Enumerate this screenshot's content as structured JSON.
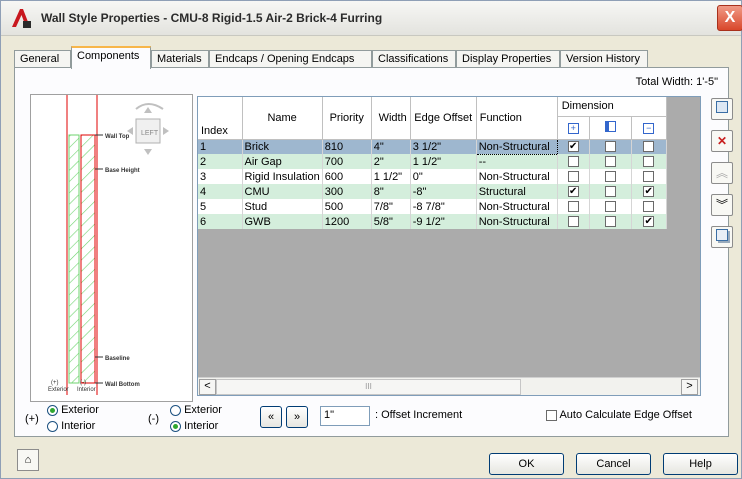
{
  "window": {
    "title": "Wall Style Properties - CMU-8 Rigid-1.5 Air-2 Brick-4 Furring",
    "close_glyph": "X"
  },
  "tabs": [
    {
      "label": "General"
    },
    {
      "label": "Components"
    },
    {
      "label": "Materials"
    },
    {
      "label": "Endcaps / Opening Endcaps"
    },
    {
      "label": "Classifications"
    },
    {
      "label": "Display Properties"
    },
    {
      "label": "Version History"
    }
  ],
  "active_tab": "Components",
  "total_width": "Total Width: 1'-5\"",
  "preview": {
    "view_label": "LEFT",
    "labels": {
      "wall_top": "Wall Top",
      "base_height": "Base Height",
      "baseline": "Baseline",
      "wall_bottom": "Wall Bottom",
      "exterior_sign": "(+)",
      "exterior": "Exterior",
      "interior_sign": "(-)",
      "interior": "Interior"
    }
  },
  "grid": {
    "headers": {
      "index": "Index",
      "name": "Name",
      "priority": "Priority",
      "width": "Width",
      "edge_offset": "Edge Offset",
      "function": "Function",
      "dimension": "Dimension"
    },
    "dimension_icons": [
      "dim-exterior-icon",
      "dim-center-icon",
      "dim-interior-icon"
    ],
    "rows": [
      {
        "index": "1",
        "name": "Brick",
        "priority": "810",
        "width": "4\"",
        "edge_offset": "3 1/2\"",
        "function": "Non-Structural",
        "d1": true,
        "d2": false,
        "d3": false
      },
      {
        "index": "2",
        "name": "Air Gap",
        "priority": "700",
        "width": "2\"",
        "edge_offset": "1 1/2\"",
        "function": "--",
        "d1": false,
        "d2": false,
        "d3": false
      },
      {
        "index": "3",
        "name": "Rigid Insulation",
        "priority": "600",
        "width": "1 1/2\"",
        "edge_offset": "0\"",
        "function": "Non-Structural",
        "d1": false,
        "d2": false,
        "d3": false
      },
      {
        "index": "4",
        "name": "CMU",
        "priority": "300",
        "width": "8\"",
        "edge_offset": "-8\"",
        "function": "Structural",
        "d1": true,
        "d2": false,
        "d3": true
      },
      {
        "index": "5",
        "name": "Stud",
        "priority": "500",
        "width": "7/8\"",
        "edge_offset": "-8 7/8\"",
        "function": "Non-Structural",
        "d1": false,
        "d2": false,
        "d3": false
      },
      {
        "index": "6",
        "name": "GWB",
        "priority": "1200",
        "width": "5/8\"",
        "edge_offset": "-9 1/2\"",
        "function": "Non-Structural",
        "d1": false,
        "d2": false,
        "d3": true
      }
    ],
    "scroll_left": "<",
    "scroll_right": ">",
    "scroll_grip": "III"
  },
  "side_buttons": [
    "add-component-icon",
    "delete-component-icon",
    "move-up-icon",
    "move-down-icon",
    "copy-icon"
  ],
  "bottom": {
    "plus_label": "(+)",
    "minus_label": "(-)",
    "plus_exterior": "Exterior",
    "plus_interior": "Interior",
    "minus_exterior": "Exterior",
    "minus_interior": "Interior",
    "prev_btn": "«",
    "next_btn": "»",
    "offset_value": "1\"",
    "offset_label": ": Offset Increment",
    "auto_calc_label": "Auto Calculate Edge Offset"
  },
  "footer": {
    "ok": "OK",
    "cancel": "Cancel",
    "help": "Help"
  },
  "colors": {
    "selected_row": "#9eb7cf",
    "alt_row": "#d4eedc",
    "active_tab_accent": "#f7b64a",
    "wall_line": "#e00000",
    "hatch": "#6fd36f"
  }
}
